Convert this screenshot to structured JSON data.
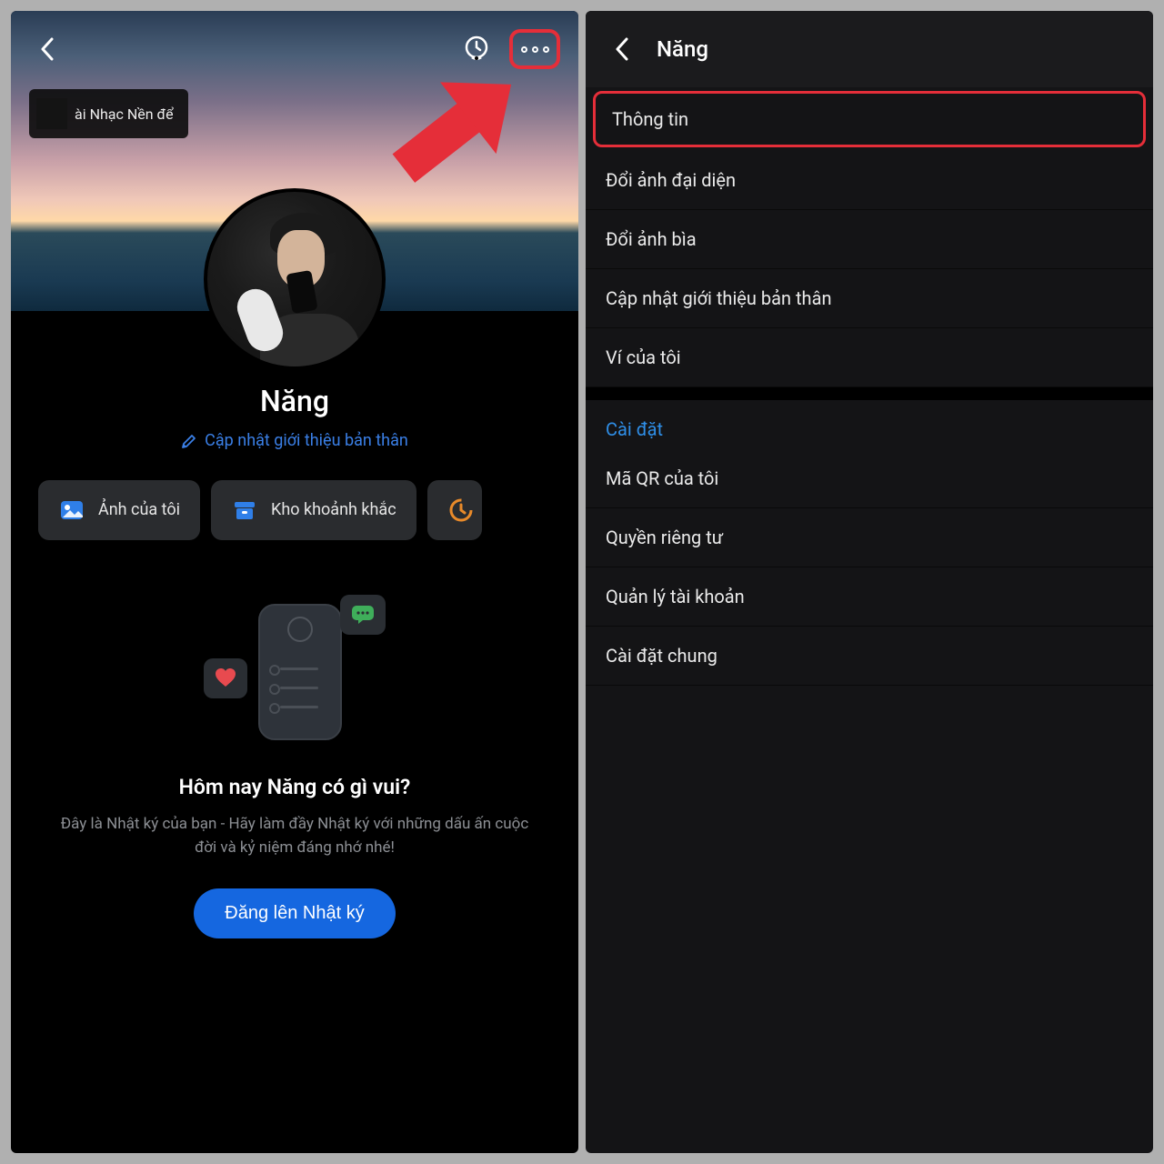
{
  "left": {
    "music_label": "ài Nhạc Nền để",
    "name": "Năng",
    "edit_bio": "Cập nhật giới thiệu bản thân",
    "chips": {
      "photos": "Ảnh của tôi",
      "moments": "Kho khoảnh khắc"
    },
    "diary_title": "Hôm nay Năng có gì vui?",
    "diary_sub": "Đây là Nhật ký của bạn - Hãy làm đầy Nhật ký với những dấu ấn cuộc đời và kỷ niệm đáng nhớ nhé!",
    "post_btn": "Đăng lên Nhật ký"
  },
  "right": {
    "title": "Năng",
    "group1": {
      "info": "Thông tin",
      "change_avatar": "Đổi ảnh đại diện",
      "change_cover": "Đổi ảnh bìa",
      "update_bio": "Cập nhật giới thiệu bản thân",
      "wallet": "Ví của tôi"
    },
    "settings_title": "Cài đặt",
    "group2": {
      "qr": "Mã QR của tôi",
      "privacy": "Quyền riêng tư",
      "account": "Quản lý tài khoản",
      "general": "Cài đặt chung"
    }
  }
}
